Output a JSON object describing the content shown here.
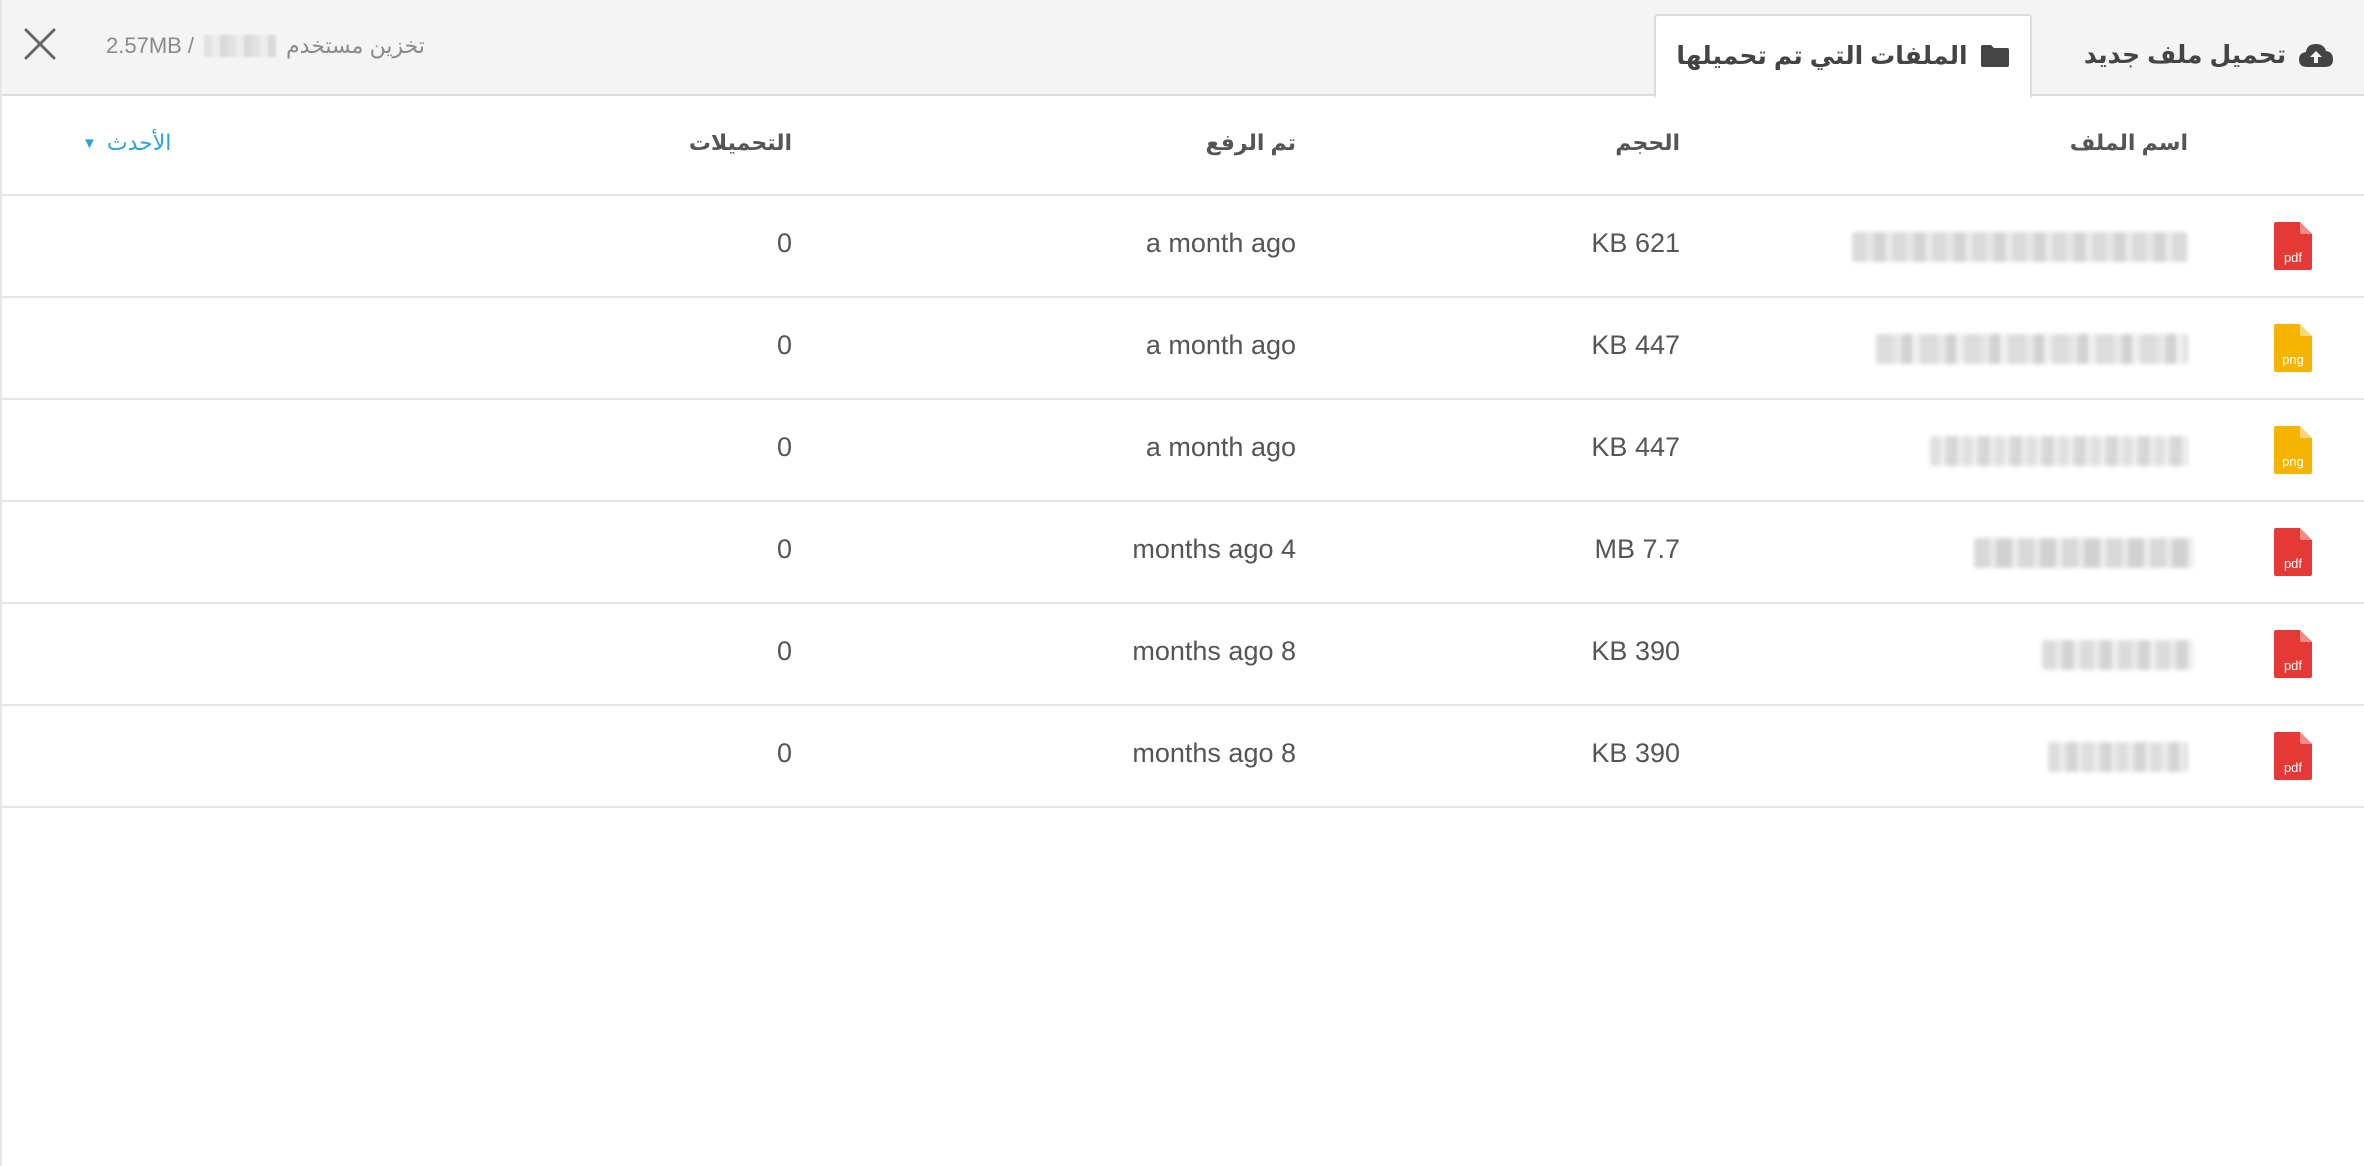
{
  "header": {
    "storage_used": "2.57MB / ",
    "storage_label": "تخزين مستخدم",
    "tabs": [
      {
        "label": "تحميل ملف جديد",
        "icon": "cloud-upload-icon",
        "active": false
      },
      {
        "label": "الملفات التي تم تحميلها",
        "icon": "folder-icon",
        "active": true
      }
    ]
  },
  "table": {
    "columns": {
      "name": "اسم الملف",
      "size": "الحجم",
      "uploaded": "تم الرفع",
      "downloads": "التحميلات"
    },
    "sort": {
      "label": "الأحدث",
      "icon": "caret-down-icon"
    },
    "rows": [
      {
        "type": "pdf",
        "size": "KB 621",
        "uploaded": "a month ago",
        "downloads": "0"
      },
      {
        "type": "png",
        "size": "KB 447",
        "uploaded": "a month ago",
        "downloads": "0"
      },
      {
        "type": "png",
        "size": "KB 447",
        "uploaded": "a month ago",
        "downloads": "0"
      },
      {
        "type": "pdf",
        "size": "MB 7.7",
        "uploaded": "months ago 4",
        "downloads": "0"
      },
      {
        "type": "pdf",
        "size": "KB 390",
        "uploaded": "months ago 8",
        "downloads": "0"
      },
      {
        "type": "pdf",
        "size": "KB 390",
        "uploaded": "months ago 8",
        "downloads": "0"
      }
    ]
  },
  "colors": {
    "pdf": "#e53935",
    "png": "#f4b400",
    "accent": "#2aa3d8"
  }
}
